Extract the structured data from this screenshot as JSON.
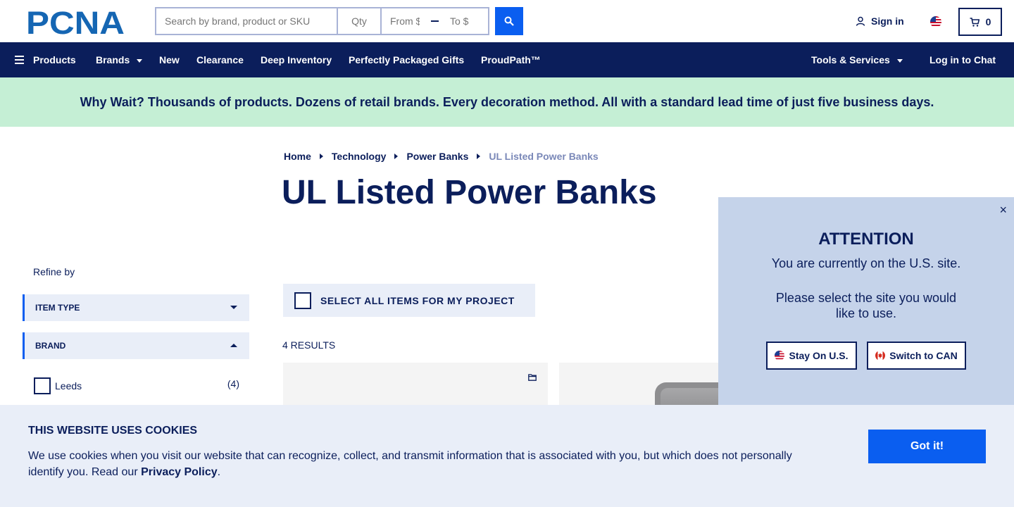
{
  "header": {
    "logo_text": "PCNA",
    "search": {
      "placeholder": "Search by brand, product or SKU",
      "value": ""
    },
    "qty": {
      "placeholder": "Qty"
    },
    "price_from": {
      "placeholder": "From $"
    },
    "price_to": {
      "placeholder": "To $"
    },
    "signin_label": "Sign in",
    "cart_count": "0"
  },
  "nav": {
    "products": "Products",
    "brands": "Brands",
    "new": "New",
    "clearance": "Clearance",
    "deep_inventory": "Deep Inventory",
    "gifts": "Perfectly Packaged Gifts",
    "proudpath": "ProudPath™",
    "tools": "Tools & Services",
    "chat": "Log in to Chat"
  },
  "promo": "Why Wait? Thousands of products. Dozens of retail brands. Every decoration method. All with a standard lead time of just five business days.",
  "breadcrumb": [
    "Home",
    "Technology",
    "Power Banks",
    "UL Listed Power Banks"
  ],
  "page_title": "UL Listed Power Banks",
  "sidebar": {
    "refine_label": "Refine by",
    "facets": [
      {
        "label": "ITEM TYPE",
        "expanded": false
      },
      {
        "label": "BRAND",
        "expanded": true
      }
    ],
    "brand_options": [
      {
        "label": "Leeds",
        "count": "(4)"
      }
    ]
  },
  "main": {
    "select_all_label": "SELECT ALL ITEMS FOR MY PROJECT",
    "results_label": "4 RESULTS"
  },
  "attention_modal": {
    "close": "×",
    "title": "ATTENTION",
    "line1": "You are currently on the U.S. site.",
    "line2": "Please select the site you would like to use.",
    "stay_label": "Stay On U.S.",
    "switch_label": "Switch to CAN"
  },
  "cookie": {
    "title": "THIS WEBSITE USES COOKIES",
    "text": "We use cookies when you visit our website that can recognize, collect, and transmit information that is associated with you, but which does not personally identify you. Read our ",
    "link": "Privacy Policy",
    "period": ".",
    "button": "Got it!"
  },
  "colors": {
    "navy": "#0b1e5b",
    "accent_blue": "#0a5ef0",
    "promo_green": "#c5efd5",
    "panel_blue": "#c5d3ea",
    "light_panel": "#e9eef8"
  },
  "icons": [
    "pcna-logo",
    "search-icon",
    "user-icon",
    "us-flag-icon",
    "cart-icon",
    "hamburger-icon",
    "folder-icon",
    "close-icon",
    "canada-flag-icon"
  ]
}
